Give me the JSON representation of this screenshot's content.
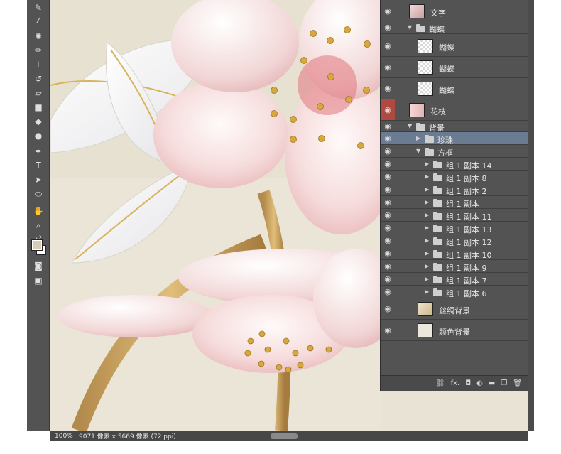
{
  "toolbar": {
    "tools": [
      "brush-icon",
      "eyedropper-icon",
      "spot-heal-icon",
      "brush-tool-icon",
      "stamp-icon",
      "history-brush-icon",
      "eraser-icon",
      "gradient-icon",
      "blur-icon",
      "dodge-icon",
      "pen-icon",
      "type-icon",
      "path-select-icon",
      "ellipse-icon",
      "hand-icon",
      "zoom-icon",
      "swap-colors-icon",
      "quick-mask-icon",
      "screen-mode-icon"
    ],
    "type_glyph": "T",
    "fg_color": "#d9ccb6",
    "bg_color": "#ffffff"
  },
  "status": {
    "zoom": "100%",
    "info": "9071 像素 x 5669 像素 (72 ppi)"
  },
  "layers": [
    {
      "name": "文字",
      "thumb": "photo",
      "indent": 0,
      "kind": "layer"
    },
    {
      "name": "蝴蝶",
      "indent": 1,
      "kind": "group-open"
    },
    {
      "name": "蝴蝶",
      "thumb": "checker",
      "indent": 2,
      "kind": "layer"
    },
    {
      "name": "蝴蝶",
      "thumb": "checker",
      "indent": 2,
      "kind": "layer"
    },
    {
      "name": "蝴蝶",
      "thumb": "checker",
      "indent": 2,
      "kind": "layer"
    },
    {
      "name": "花枝",
      "thumb": "flower",
      "indent": 0,
      "kind": "layer",
      "eye_red": true
    },
    {
      "name": "背景",
      "indent": 1,
      "kind": "group-open"
    },
    {
      "name": "珍珠",
      "indent": 2,
      "kind": "group-closed",
      "selected": true
    },
    {
      "name": "方框",
      "indent": 2,
      "kind": "group-open"
    },
    {
      "name": "组 1 副本 14",
      "indent": 3,
      "kind": "group-closed"
    },
    {
      "name": "组 1 副本 8",
      "indent": 3,
      "kind": "group-closed"
    },
    {
      "name": "组 1 副本 2",
      "indent": 3,
      "kind": "group-closed"
    },
    {
      "name": "组 1 副本",
      "indent": 3,
      "kind": "group-closed"
    },
    {
      "name": "组 1 副本 11",
      "indent": 3,
      "kind": "group-closed"
    },
    {
      "name": "组 1 副本 13",
      "indent": 3,
      "kind": "group-closed"
    },
    {
      "name": "组 1 副本 12",
      "indent": 3,
      "kind": "group-closed"
    },
    {
      "name": "组 1 副本 10",
      "indent": 3,
      "kind": "group-closed"
    },
    {
      "name": "组 1 副本 9",
      "indent": 3,
      "kind": "group-closed"
    },
    {
      "name": "组 1 副本 7",
      "indent": 3,
      "kind": "group-closed"
    },
    {
      "name": "组 1 副本 6",
      "indent": 3,
      "kind": "group-closed"
    },
    {
      "name": "丝绸背景",
      "thumb": "silk",
      "indent": 2,
      "kind": "layer"
    },
    {
      "name": "颜色背景",
      "thumb": "plain",
      "indent": 2,
      "kind": "layer"
    }
  ],
  "footer": {
    "icons": [
      "link-layers-icon",
      "fx-icon",
      "add-mask-icon",
      "adjustment-icon",
      "new-group-icon",
      "new-layer-icon",
      "delete-layer-icon"
    ],
    "fx_label": "fx."
  },
  "colors": {
    "panel_bg": "#535353",
    "selection": "#6b7b91",
    "eye_highlight": "#b04a40",
    "canvas_bg": "#e9e3d5"
  }
}
